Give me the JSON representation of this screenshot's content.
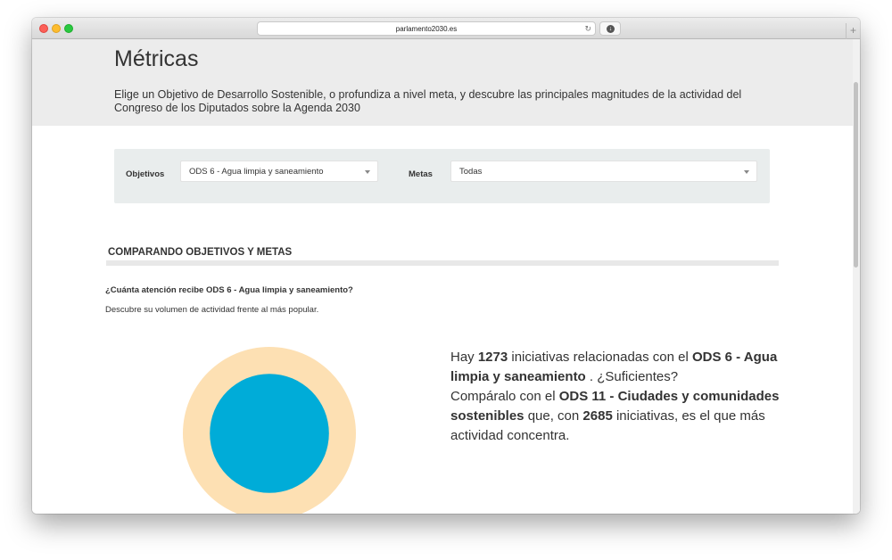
{
  "browser": {
    "url": "parlamento2030.es",
    "reload_icon": "reload-icon",
    "download_icon": "download-icon",
    "new_tab_icon": "plus-icon"
  },
  "header": {
    "title": "Métricas",
    "subtitle": "Elige un Objetivo de Desarrollo Sostenible, o profundiza a nivel meta, y descubre las principales magnitudes de la actividad del Congreso de los Diputados sobre la Agenda 2030"
  },
  "filters": {
    "objetivos_label": "Objetivos",
    "objetivos_value": "ODS 6 - Agua limpia y saneamiento",
    "metas_label": "Metas",
    "metas_value": "Todas"
  },
  "section": {
    "heading": "COMPARANDO OBJETIVOS Y METAS",
    "question": "¿Cuánta atención recibe ODS 6 - Agua limpia y saneamiento?",
    "description": "Descubre su volumen de actividad frente al más popular."
  },
  "stats": {
    "p1": "Hay ",
    "count_selected": "1273",
    "p2": " iniciativas relacionadas con el ",
    "selected_name": "ODS 6 - Agua limpia y saneamiento",
    "p3": " . ¿Suficientes?",
    "p4": "Compáralo con el ",
    "top_name": "ODS 11 - Ciudades y comunidades sostenibles",
    "p5": " que, con ",
    "count_top": "2685",
    "p6": " iniciativas, es el que más actividad concentra."
  },
  "chart_data": {
    "type": "bubble",
    "series": [
      {
        "name": "ODS 11 - Ciudades y comunidades sostenibles",
        "value": 2685,
        "color": "#fde0b3"
      },
      {
        "name": "ODS 6 - Agua limpia y saneamiento",
        "value": 1273,
        "color": "#00acd8"
      }
    ]
  },
  "colors": {
    "header_bg": "#ececec",
    "filter_bg": "#e9eded",
    "outer_bubble": "#fde0b3",
    "inner_bubble": "#00acd8"
  }
}
